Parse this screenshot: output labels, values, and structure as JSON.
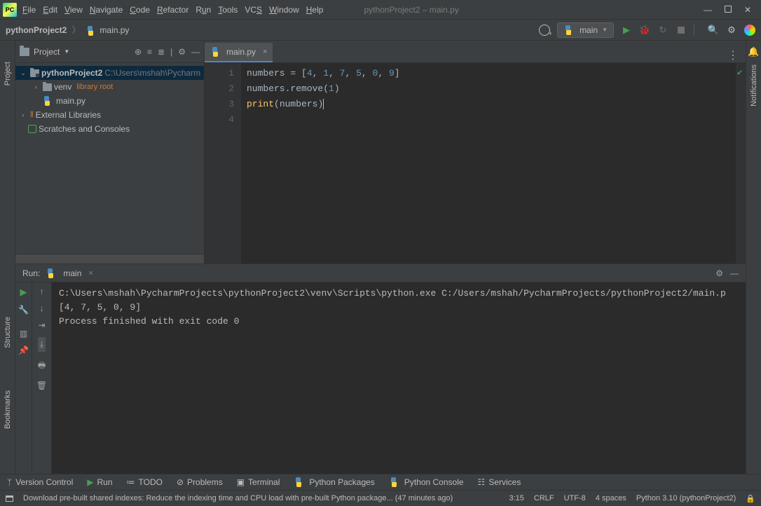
{
  "window": {
    "title": "pythonProject2 – main.py"
  },
  "menu": {
    "file": "File",
    "edit": "Edit",
    "view": "View",
    "navigate": "Navigate",
    "code": "Code",
    "refactor": "Refactor",
    "run": "Run",
    "tools": "Tools",
    "vcs": "VCS",
    "window": "Window",
    "help": "Help"
  },
  "nav": {
    "project": "pythonProject2",
    "file": "main.py",
    "run_config": "main"
  },
  "project_panel": {
    "title": "Project",
    "root": "pythonProject2",
    "root_path": "C:\\Users\\mshah\\Pycharm",
    "venv": "venv",
    "venv_tag": "library root",
    "mainpy": "main.py",
    "ext_libs": "External Libraries",
    "scratches": "Scratches and Consoles"
  },
  "editor": {
    "tab": "main.py",
    "lines": [
      "1",
      "2",
      "3",
      "4"
    ],
    "code": {
      "l1_id": "numbers",
      "l1_eq": " = ",
      "l1_open": "[",
      "l1_n1": "4",
      "l1_c": ", ",
      "l1_n2": "1",
      "l1_n3": "7",
      "l1_n4": "5",
      "l1_n5": "0",
      "l1_n6": "9",
      "l1_close": "]",
      "l2_id": "numbers",
      "l2_dot": ".",
      "l2_fn": "remove",
      "l2_open": "(",
      "l2_arg": "1",
      "l2_close": ")",
      "l3_fn": "print",
      "l3_open": "(",
      "l3_arg": "numbers",
      "l3_close": ")"
    }
  },
  "run_panel": {
    "label": "Run:",
    "tab": "main",
    "line1": "C:\\Users\\mshah\\PycharmProjects\\pythonProject2\\venv\\Scripts\\python.exe C:/Users/mshah/PycharmProjects/pythonProject2/main.p",
    "line2": "[4, 7, 5, 0, 9]",
    "line3": "",
    "line4": "Process finished with exit code 0"
  },
  "tools": {
    "vcs": "Version Control",
    "run": "Run",
    "todo": "TODO",
    "problems": "Problems",
    "terminal": "Terminal",
    "pypkg": "Python Packages",
    "pyconsole": "Python Console",
    "services": "Services"
  },
  "status": {
    "msg": "Download pre-built shared indexes: Reduce the indexing time and CPU load with pre-built Python package... (47 minutes ago)",
    "cursor": "3:15",
    "crlf": "CRLF",
    "enc": "UTF-8",
    "indent": "4 spaces",
    "interp": "Python 3.10 (pythonProject2)"
  },
  "right_rail": {
    "notifications": "Notifications"
  }
}
